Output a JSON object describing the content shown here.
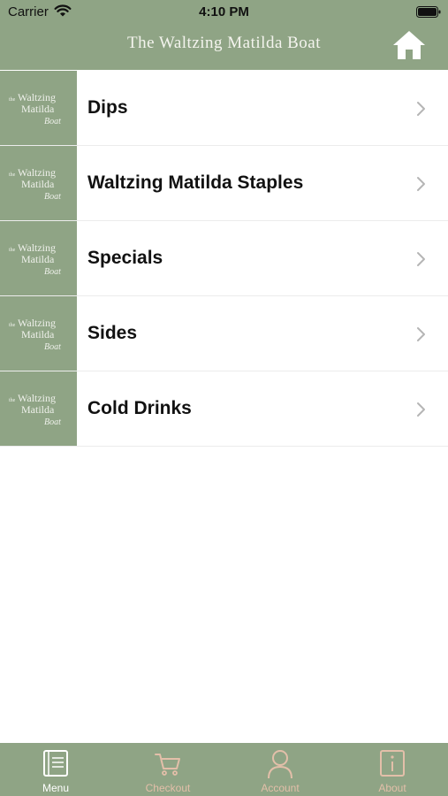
{
  "status_bar": {
    "carrier": "Carrier",
    "time": "4:10 PM",
    "wifi_icon": "wifi-icon",
    "battery_icon": "battery-icon"
  },
  "header": {
    "title": "The Waltzing Matilda Boat",
    "home_icon": "home-icon"
  },
  "menu": {
    "items": [
      {
        "label": "Dips"
      },
      {
        "label": "Waltzing Matilda Staples"
      },
      {
        "label": "Specials"
      },
      {
        "label": "Sides"
      },
      {
        "label": "Cold Drinks"
      }
    ],
    "thumbnail_logo": {
      "line1": "Waltzing",
      "line2": "Matilda",
      "line3": "Boat",
      "prefix": "the"
    }
  },
  "tabbar": {
    "tabs": [
      {
        "label": "Menu",
        "icon": "menu-book-icon",
        "active": true
      },
      {
        "label": "Checkout",
        "icon": "cart-icon",
        "active": false
      },
      {
        "label": "Account",
        "icon": "user-icon",
        "active": false
      },
      {
        "label": "About",
        "icon": "info-icon",
        "active": false
      }
    ]
  },
  "colors": {
    "brand_green": "#8fa485",
    "active_tab": "#ffffff",
    "inactive_tab": "#e3bfa9",
    "header_text": "#f4f4ee"
  }
}
